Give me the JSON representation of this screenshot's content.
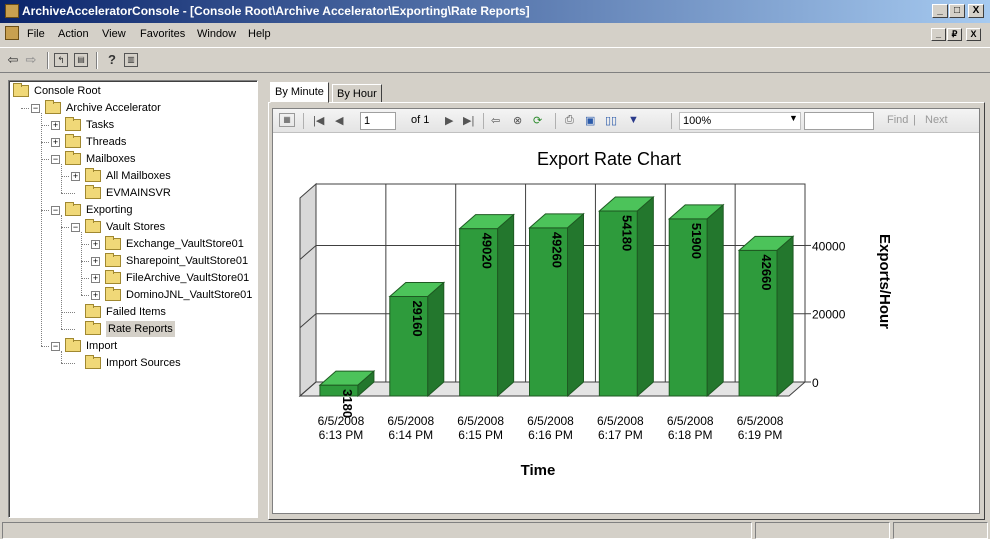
{
  "window": {
    "title": "ArchiveAcceleratorConsole - [Console Root\\Archive Accelerator\\Exporting\\Rate Reports]",
    "caption_buttons": [
      "_",
      "□",
      "X"
    ],
    "mdi_buttons": [
      "_",
      "₽",
      "X"
    ]
  },
  "menu": {
    "items": [
      {
        "label": "File"
      },
      {
        "label": "Action"
      },
      {
        "label": "View"
      },
      {
        "label": "Favorites"
      },
      {
        "label": "Window"
      },
      {
        "label": "Help"
      }
    ]
  },
  "toolbar": {
    "icons": [
      "back-arrow-icon",
      "forward-arrow-icon",
      "up-folder-icon",
      "show-hide-tree-icon",
      "help-icon",
      "properties-icon"
    ]
  },
  "tree": {
    "nodes": [
      {
        "label": "Console Root",
        "level": 0,
        "expander": "",
        "selected": false
      },
      {
        "label": "Archive Accelerator",
        "level": 1,
        "expander": "−",
        "selected": false
      },
      {
        "label": "Tasks",
        "level": 2,
        "expander": "+",
        "selected": false
      },
      {
        "label": "Threads",
        "level": 2,
        "expander": "+",
        "selected": false
      },
      {
        "label": "Mailboxes",
        "level": 2,
        "expander": "−",
        "selected": false
      },
      {
        "label": "All Mailboxes",
        "level": 3,
        "expander": "+",
        "selected": false
      },
      {
        "label": "EVMAINSVR",
        "level": 3,
        "expander": "",
        "selected": false
      },
      {
        "label": "Exporting",
        "level": 2,
        "expander": "−",
        "selected": false
      },
      {
        "label": "Vault Stores",
        "level": 3,
        "expander": "−",
        "selected": false
      },
      {
        "label": "Exchange_VaultStore01",
        "level": 4,
        "expander": "+",
        "selected": false
      },
      {
        "label": "Sharepoint_VaultStore01",
        "level": 4,
        "expander": "+",
        "selected": false
      },
      {
        "label": "FileArchive_VaultStore01",
        "level": 4,
        "expander": "+",
        "selected": false
      },
      {
        "label": "DominoJNL_VaultStore01",
        "level": 4,
        "expander": "+",
        "selected": false
      },
      {
        "label": "Failed Items",
        "level": 3,
        "expander": "",
        "selected": false
      },
      {
        "label": "Rate Reports",
        "level": 3,
        "expander": "",
        "selected": true
      },
      {
        "label": "Import",
        "level": 2,
        "expander": "−",
        "selected": false
      },
      {
        "label": "Import Sources",
        "level": 3,
        "expander": "",
        "selected": false
      }
    ]
  },
  "tabs": [
    {
      "label": "By Minute",
      "active": true
    },
    {
      "label": "By Hour",
      "active": false
    }
  ],
  "report_toolbar": {
    "page_input": "1",
    "page_of": "of 1",
    "zoom": "100%",
    "find_label": "Find",
    "separator": "|",
    "next_label": "Next"
  },
  "chart_data": {
    "type": "bar",
    "title": "Export Rate Chart",
    "xlabel": "Time",
    "ylabel": "Exports/Hour",
    "categories": [
      [
        "6/5/2008",
        "6:13 PM"
      ],
      [
        "6/5/2008",
        "6:14 PM"
      ],
      [
        "6/5/2008",
        "6:15 PM"
      ],
      [
        "6/5/2008",
        "6:16 PM"
      ],
      [
        "6/5/2008",
        "6:17 PM"
      ],
      [
        "6/5/2008",
        "6:18 PM"
      ],
      [
        "6/5/2008",
        "6:19 PM"
      ]
    ],
    "values": [
      3180,
      29160,
      49020,
      49260,
      54180,
      51900,
      42660
    ],
    "value_labels": [
      "3180",
      "29160",
      "49020",
      "49260",
      "54180",
      "51900",
      "42660"
    ],
    "yticks": [
      0,
      20000,
      40000
    ],
    "ylim": [
      0,
      58000
    ],
    "axis_side": "right",
    "style": "3d",
    "bar_color": "#2e9b3c",
    "grid": true
  },
  "statusbar": {
    "panels": [
      "",
      "",
      ""
    ]
  }
}
